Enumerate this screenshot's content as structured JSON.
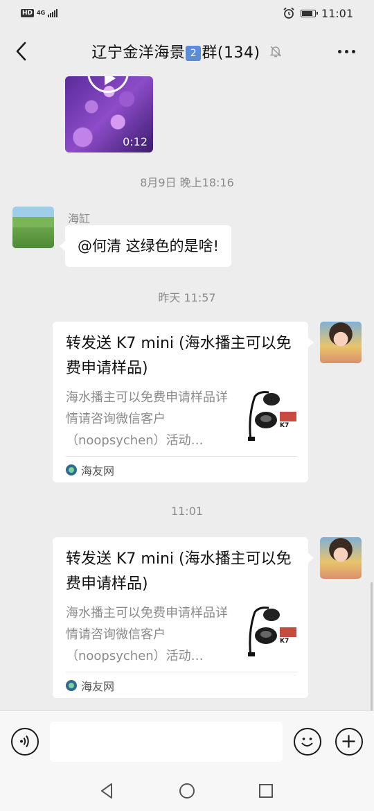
{
  "status_bar": {
    "hd": "HD",
    "network": "4G",
    "time": "11:01",
    "battery_level": 0.75
  },
  "header": {
    "title_prefix": "辽宁金洋海景",
    "title_badge": "2",
    "title_suffix": "群(134)",
    "back_icon": "back-arrow-icon",
    "mute_icon": "bell-muted-icon",
    "more_icon": "more-dots-icon"
  },
  "messages": {
    "video": {
      "duration": "0:12"
    },
    "time1": "8月9日 晚上18:16",
    "text_msg": {
      "sender": "海缸",
      "text": "@何清  这绿色的是啥!"
    },
    "time2": "昨天 11:57",
    "card1": {
      "title": "转发送 K7 mini (海水播主可以免费申请样品)",
      "desc": "海水播主可以免费申请样品详情请咨询微信客户（noopsychen）活动…",
      "source": "海友网",
      "thumb_brand": "K7"
    },
    "time3": "11:01",
    "card2": {
      "title": "转发送 K7 mini (海水播主可以免费申请样品)",
      "desc": "海水播主可以免费申请样品详情请咨询微信客户（noopsychen）活动…",
      "source": "海友网",
      "thumb_brand": "K7"
    }
  },
  "input_bar": {
    "voice_icon": "voice-icon",
    "input_value": "",
    "emoji_icon": "emoji-icon",
    "plus_icon": "plus-icon"
  },
  "colors": {
    "background": "#ededed",
    "bubble": "#ffffff",
    "badge": "#5b8dd6"
  }
}
